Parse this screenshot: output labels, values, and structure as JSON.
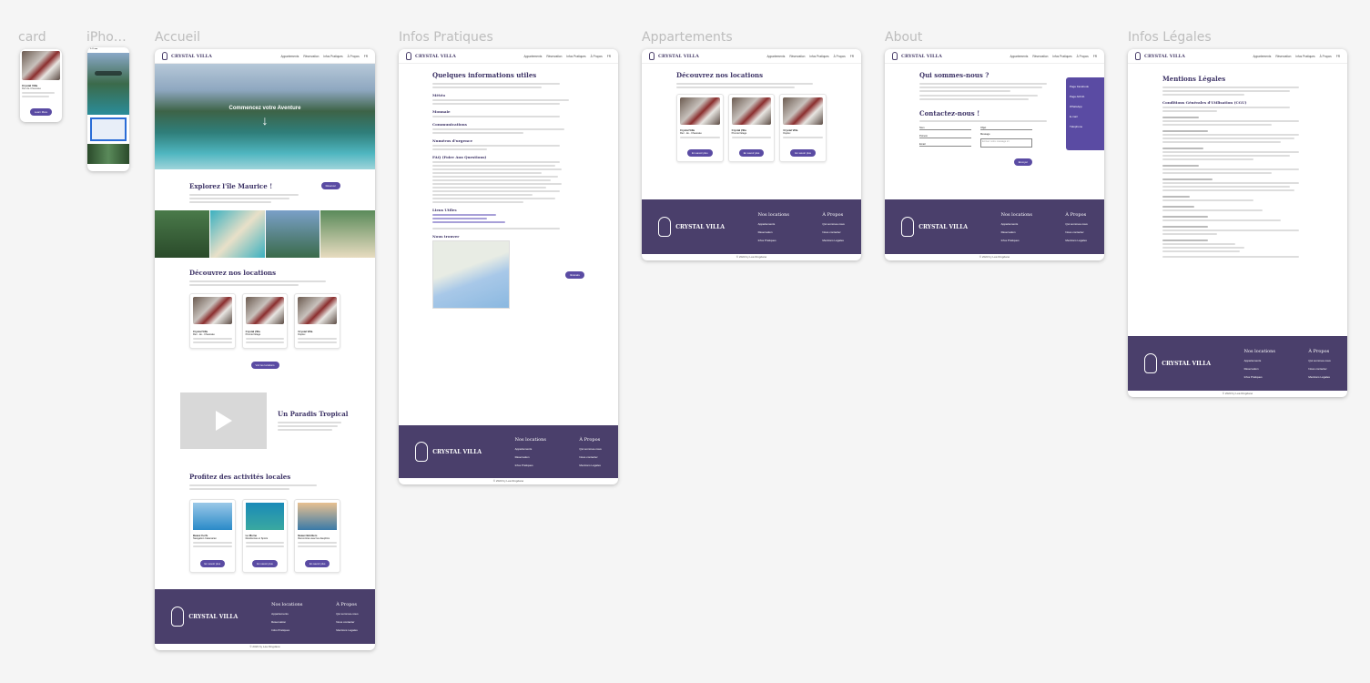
{
  "frames": {
    "card": "card",
    "iphone": "iPho…",
    "accueil": "Accueil",
    "infos": "Infos Pratiques",
    "appart": "Appartements",
    "about": "About",
    "legal": "Infos Légales"
  },
  "brand": "CRYSTAL VILLA",
  "nav": [
    "Appartements",
    "Réservation",
    "Infos Pratiques",
    "À Propos",
    "FR"
  ],
  "hero": {
    "title": "Commencez votre Aventure"
  },
  "explore": {
    "title": "Explorez l'île Maurice !",
    "btn": "Réserver"
  },
  "locations": {
    "title": "Découvrez nos locations",
    "btn_all": "Voir les locations"
  },
  "cards": [
    {
      "name": "Crystal Villa",
      "sub": "Rez - de - Chaussée",
      "btn": "En savoir plus"
    },
    {
      "name": "Crystal Villa",
      "sub": "Premier Étage",
      "btn": "En savoir plus"
    },
    {
      "name": "Crystal Villa",
      "sub": "Duplex",
      "btn": "En savoir plus"
    }
  ],
  "video": {
    "title": "Un Paradis Tropical"
  },
  "activities": {
    "title": "Profitez des activités locales",
    "items": [
      {
        "name": "Beaux Cerfs",
        "sub": "Navigation Catamaran",
        "btn": "En savoir plus"
      },
      {
        "name": "Le Morne",
        "sub": "Randonnée et Sports",
        "btn": "En savoir plus"
      },
      {
        "name": "Beaux Bénitiers",
        "sub": "Rencontres avec les dauphins",
        "btn": "En savoir plus"
      }
    ]
  },
  "footer": {
    "locations": "Nos locations",
    "links1": [
      "Appartements",
      "Réservation",
      "Infos Pratiques"
    ],
    "about": "À Propos",
    "links2": [
      "Qui sommes-nous",
      "Nous contacter",
      "Mentions Légales"
    ],
    "copy": "© 2023 by Léa Dingdané"
  },
  "infos": {
    "title": "Quelques informations utiles",
    "h": [
      "Météo",
      "Monnaie",
      "Communications",
      "Numéros d'urgence",
      "FAQ (Foire Aux Questions)",
      "Liens Utiles",
      "Nous trouver"
    ],
    "btn": "Itinéraire"
  },
  "about": {
    "title": "Qui sommes-nous ?",
    "contact": "Contactez-nous !",
    "side": [
      "Page Facebook",
      "Page Airbnb",
      "WhatsApp",
      "E-mail",
      "Téléphone"
    ],
    "fields": [
      "Nom",
      "Prénom",
      "Email",
      "Objet",
      "Message"
    ],
    "msg_placeholder": "Ecrivez votre message ici",
    "send": "Envoyer"
  },
  "legal": {
    "title": "Mentions Légales",
    "cgu": "Conditions Générales d'Utilisation (CGU)"
  },
  "card_frame": {
    "name": "Crystal Villa",
    "sub": "Rez-de-Chaussée",
    "btn": "Learn More"
  }
}
